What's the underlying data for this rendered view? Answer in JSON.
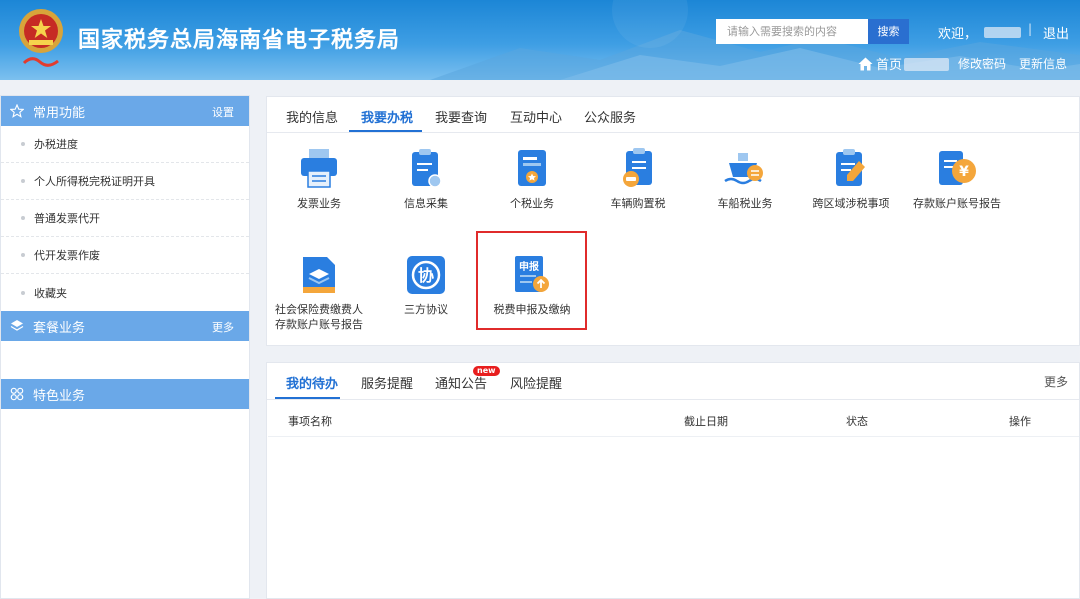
{
  "header": {
    "title": "国家税务总局海南省电子税务局",
    "search_placeholder": "请输入需要搜索的内容",
    "search_button": "搜索",
    "welcome": "欢迎，",
    "separator": "|",
    "logout": "退出",
    "home": "首页",
    "change_password": "修改密码",
    "update_info": "更新信息"
  },
  "sidebar": {
    "common": {
      "title": "常用功能",
      "action": "设置"
    },
    "items": [
      {
        "label": "办税进度"
      },
      {
        "label": "个人所得税完税证明开具"
      },
      {
        "label": "普通发票代开"
      },
      {
        "label": "代开发票作废"
      },
      {
        "label": "收藏夹"
      }
    ],
    "package": {
      "title": "套餐业务",
      "action": "更多"
    },
    "special": {
      "title": "特色业务"
    }
  },
  "main_tabs": [
    {
      "label": "我的信息"
    },
    {
      "label": "我要办税"
    },
    {
      "label": "我要查询"
    },
    {
      "label": "互动中心"
    },
    {
      "label": "公众服务"
    }
  ],
  "tiles": [
    {
      "label": "发票业务",
      "icon": "printer-icon"
    },
    {
      "label": "信息采集",
      "icon": "clipboard-icon"
    },
    {
      "label": "个税业务",
      "icon": "document-star-icon"
    },
    {
      "label": "车辆购置税",
      "icon": "car-clipboard-icon"
    },
    {
      "label": "车船税业务",
      "icon": "ship-icon"
    },
    {
      "label": "跨区域涉税事项",
      "icon": "clipboard-pen-icon"
    },
    {
      "label": "存款账户账号报告",
      "icon": "yen-document-icon"
    },
    {
      "label": "社会保险费缴费人存款账户账号报告",
      "label_line1": "社会保险费缴费人",
      "label_line2": "存款账户账号报告",
      "icon": "layers-icon"
    },
    {
      "label": "三方协议",
      "icon": "agreement-icon",
      "glyph": "协"
    },
    {
      "label": "税费申报及缴纳",
      "icon": "declaration-icon",
      "glyph": "申报"
    }
  ],
  "todo": {
    "tabs": [
      {
        "label": "我的待办"
      },
      {
        "label": "服务提醒"
      },
      {
        "label": "通知公告",
        "badge": "new"
      },
      {
        "label": "风险提醒"
      }
    ],
    "more": "更多",
    "columns": [
      "事项名称",
      "截止日期",
      "状态",
      "操作"
    ]
  },
  "colors": {
    "accent": "#2271d4",
    "sidebar_header": "#6aa8e8",
    "highlight_border": "#e02b2b",
    "badge": "#e81e1e"
  }
}
